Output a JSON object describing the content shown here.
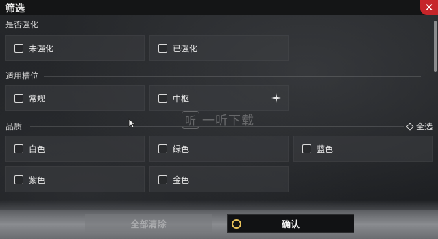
{
  "header": {
    "title": "筛选",
    "close_glyph": "✕"
  },
  "sections": {
    "enhance": {
      "label": "是否强化",
      "options": [
        "未强化",
        "已强化"
      ]
    },
    "slot": {
      "label": "适用槽位",
      "options": [
        "常规",
        "中枢"
      ]
    },
    "quality": {
      "label": "品质",
      "select_all": "全选",
      "options": [
        "白色",
        "绿色",
        "蓝色",
        "紫色",
        "金色"
      ]
    }
  },
  "watermark": {
    "glyph": "听",
    "text": "一听下载"
  },
  "footer": {
    "clear_label": "全部清除",
    "confirm_label": "确认"
  },
  "colors": {
    "close_red": "#c6252a",
    "accent_gold": "#e8c25a"
  }
}
